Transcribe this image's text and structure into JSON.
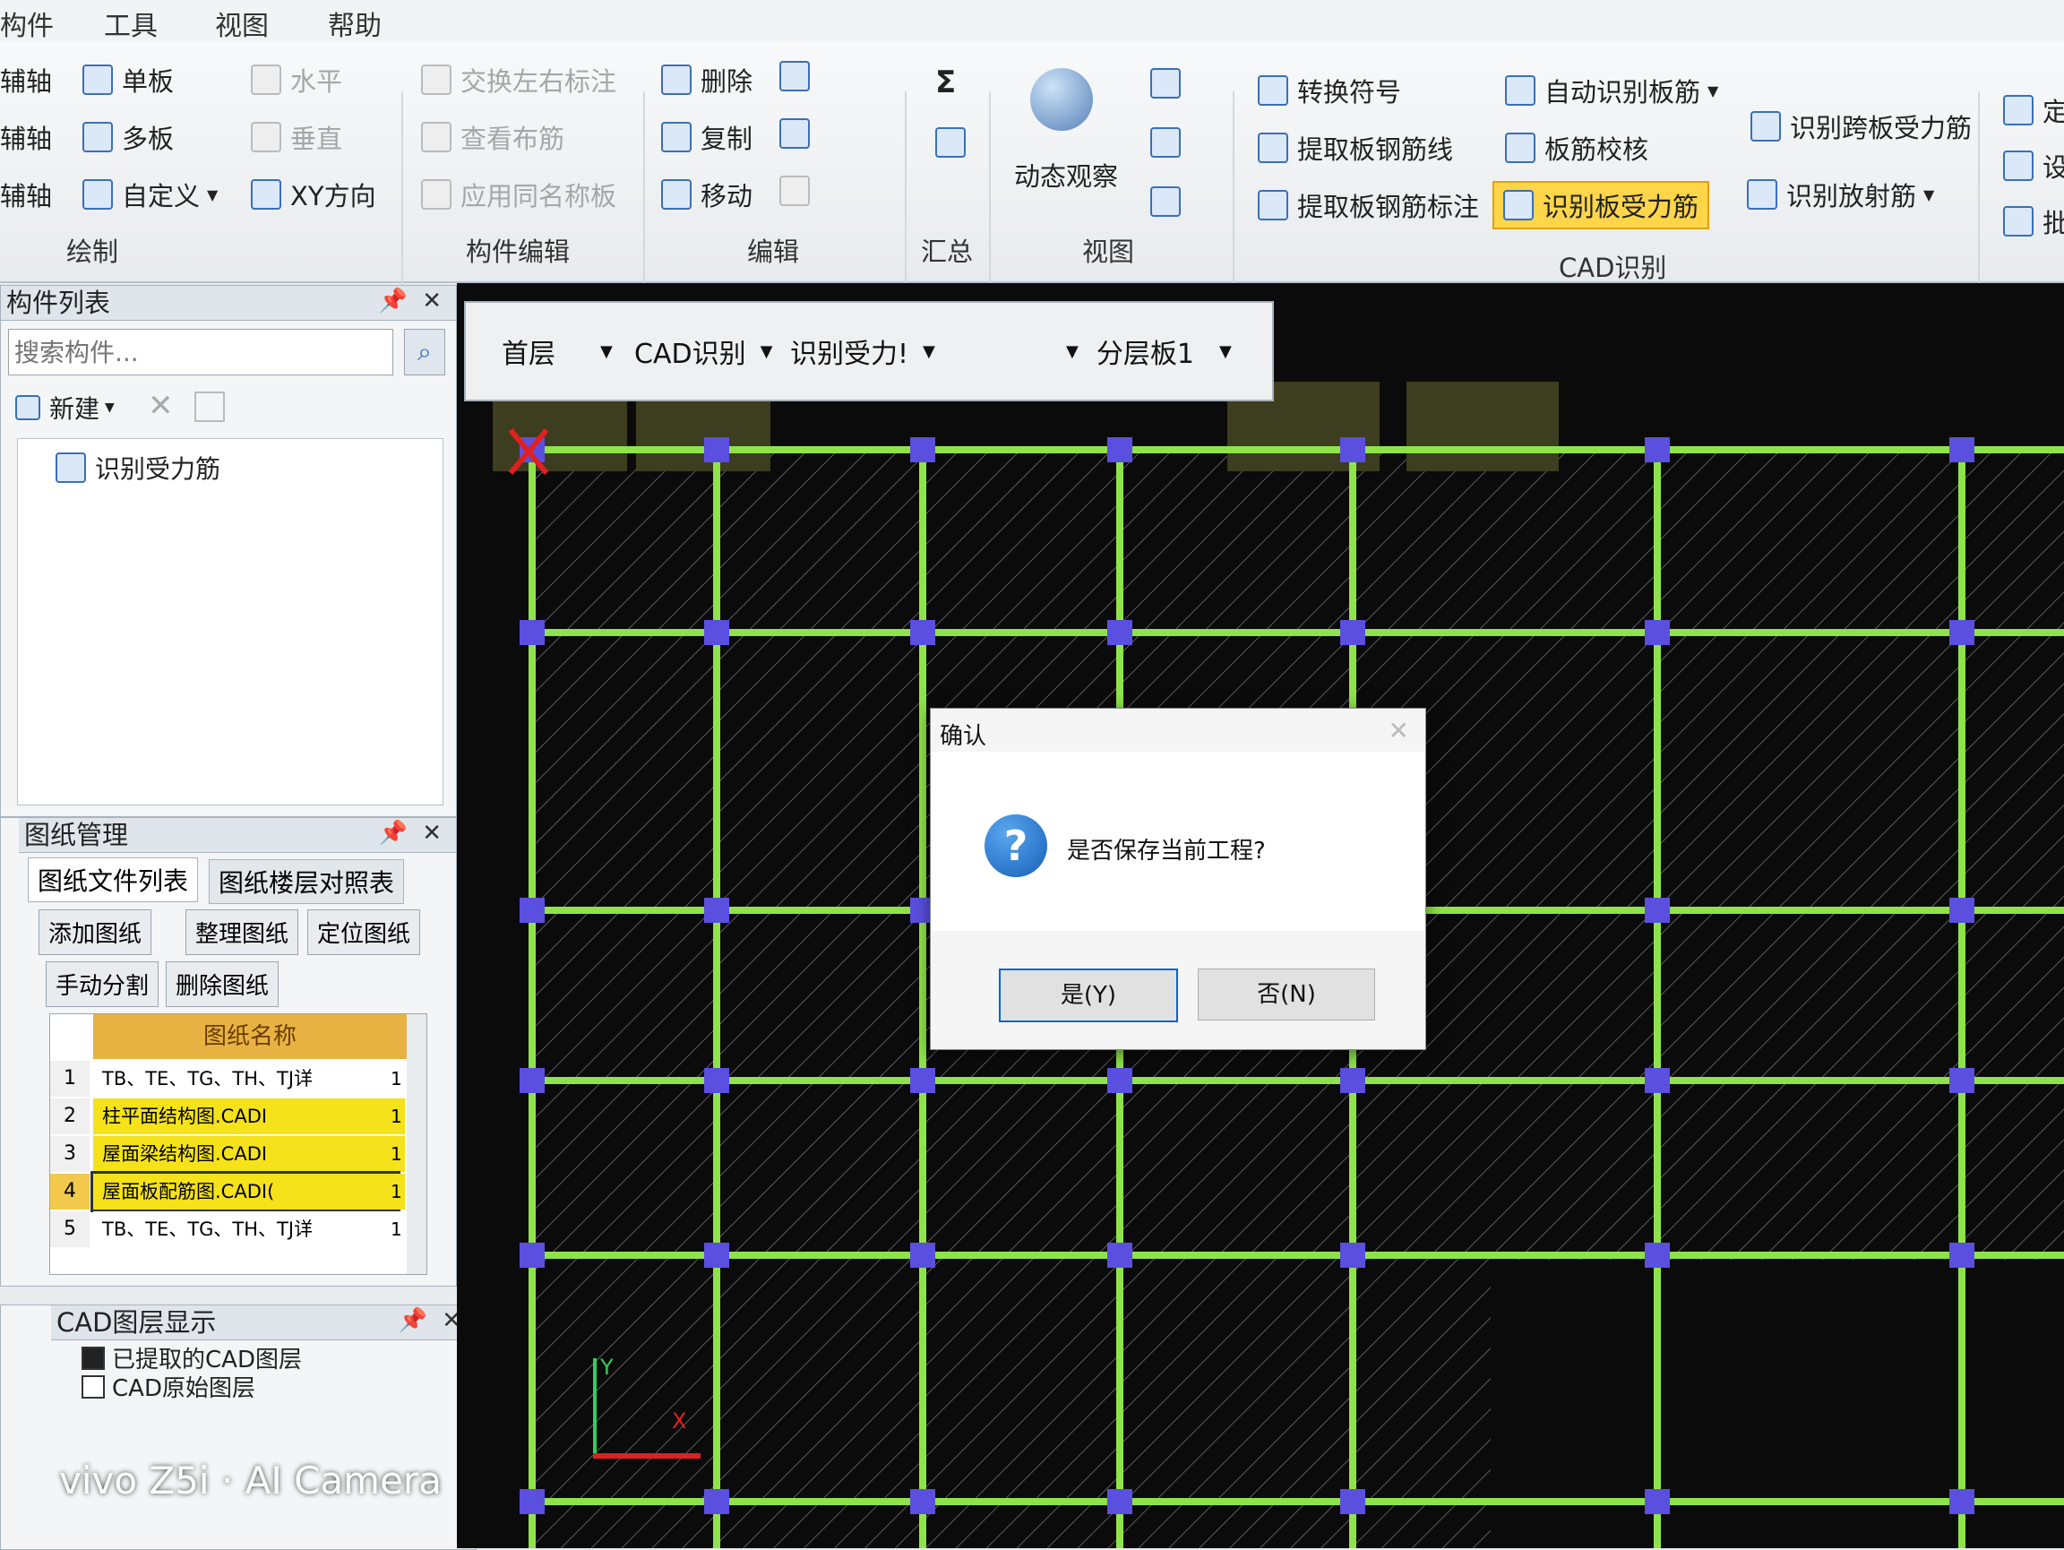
{
  "menubar": {
    "items": [
      "构件",
      "工具",
      "视图",
      "帮助"
    ]
  },
  "ribbon": {
    "draw": {
      "label": "绘制",
      "items": [
        "辅轴",
        "单板",
        "水平",
        "辅轴",
        "多板",
        "垂直",
        "辅轴",
        "自定义",
        "XY方向"
      ]
    },
    "component_edit": {
      "label": "构件编辑",
      "items": [
        "交换左右标注",
        "查看布筋",
        "应用同名称板"
      ]
    },
    "edit": {
      "label": "编辑",
      "items": [
        "删除",
        "复制",
        "移动"
      ]
    },
    "summary": {
      "label": "汇总",
      "items": [
        "Σ"
      ]
    },
    "view": {
      "label": "视图",
      "items": [
        "动态观察"
      ]
    },
    "cad": {
      "label": "CAD识别",
      "items": [
        "转换符号",
        "提取板钢筋线",
        "提取板钢筋标注",
        "自动识别板筋",
        "板筋校核",
        "识别板受力筋",
        "识别跨板受力筋",
        "识别放射筋"
      ]
    },
    "extra": {
      "items": [
        "定",
        "设",
        "批"
      ]
    }
  },
  "component_panel": {
    "title": "构件列表",
    "search_placeholder": "搜索构件...",
    "new_label": "新建",
    "tree_item": "识别受力筋"
  },
  "drawing_panel": {
    "title": "图纸管理",
    "tabs": [
      "图纸文件列表",
      "图纸楼层对照表"
    ],
    "buttons": [
      "添加图纸",
      "整理图纸",
      "定位图纸",
      "手动分割",
      "删除图纸"
    ],
    "column_header": "图纸名称",
    "rows": [
      {
        "num": "1",
        "name": "TB、TE、TG、TH、TJ详",
        "tail": "1"
      },
      {
        "num": "2",
        "name": "柱平面结构图.CADI",
        "tail": "1"
      },
      {
        "num": "3",
        "name": "屋面梁结构图.CADI",
        "tail": "1"
      },
      {
        "num": "4",
        "name": "屋面板配筋图.CADI(",
        "tail": "1"
      },
      {
        "num": "5",
        "name": "TB、TE、TG、TH、TJ详",
        "tail": "1"
      }
    ]
  },
  "layer_panel": {
    "title": "CAD图层显示",
    "items": [
      "已提取的CAD图层",
      "CAD原始图层"
    ]
  },
  "floating_toolbar": {
    "floor": "首层",
    "mode": "CAD识别",
    "type": "识别受力!",
    "layer": "分层板1"
  },
  "dialog": {
    "title": "确认",
    "message": "是否保存当前工程?",
    "yes": "是(Y)",
    "no": "否(N)"
  },
  "axis": {
    "x": "X",
    "y": "Y"
  },
  "watermark": "vivo Z5i · AI Camera",
  "colors": {
    "grid_line": "#8fe34a",
    "node": "#5b4fe0",
    "canvas_bg": "#0b0b0b",
    "highlight": "#ffd54a"
  }
}
